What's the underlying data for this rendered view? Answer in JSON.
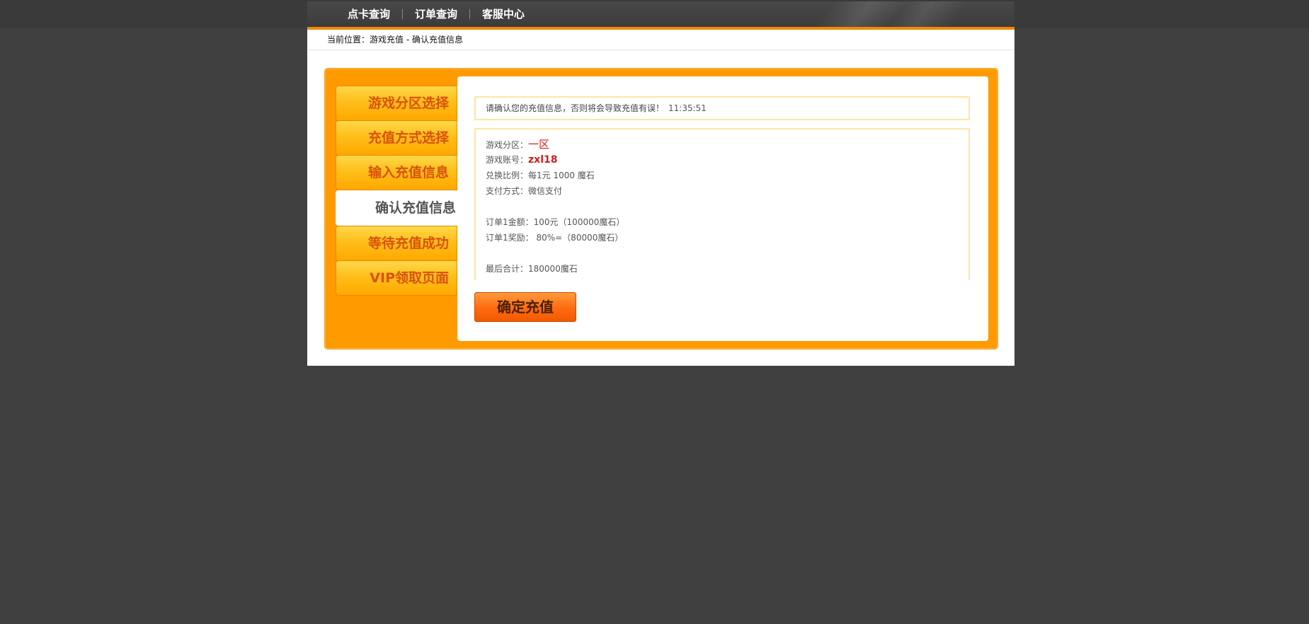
{
  "nav": {
    "items": [
      "点卡查询",
      "订单查询",
      "客服中心"
    ]
  },
  "breadcrumb": {
    "text": "当前位置：游戏充值 - 确认充值信息"
  },
  "steps": [
    {
      "label": "游戏分区选择",
      "active": false
    },
    {
      "label": "充值方式选择",
      "active": false
    },
    {
      "label": "输入充值信息",
      "active": false
    },
    {
      "label": "确认充值信息",
      "active": true
    },
    {
      "label": "等待充值成功",
      "active": false
    },
    {
      "label": "VIP领取页面",
      "active": false
    }
  ],
  "notice": {
    "text": "请确认您的充值信息，否则将会导致充值有误！",
    "time": "11:35:51"
  },
  "info": {
    "zone_label": "游戏分区：",
    "zone_value": "一区",
    "account_label": "游戏账号：",
    "account_value": "zxl18",
    "ratio_label": "兑换比例：",
    "ratio_value": "每1元 1000 魔石",
    "pay_label": "支付方式：",
    "pay_value": "微信支付",
    "amount_label": "订单1金额：",
    "amount_value": "100元（100000魔石）",
    "bonus_label": "订单1奖励：",
    "bonus_value": " 80%=（80000魔石）",
    "total_label": "最后合计：",
    "total_value": "180000魔石"
  },
  "confirm_button": {
    "label": "确定充值"
  },
  "colors": {
    "page_bg": "#404040",
    "accent_orange": "#ff9a00",
    "highlight_red": "#d31c1c"
  }
}
